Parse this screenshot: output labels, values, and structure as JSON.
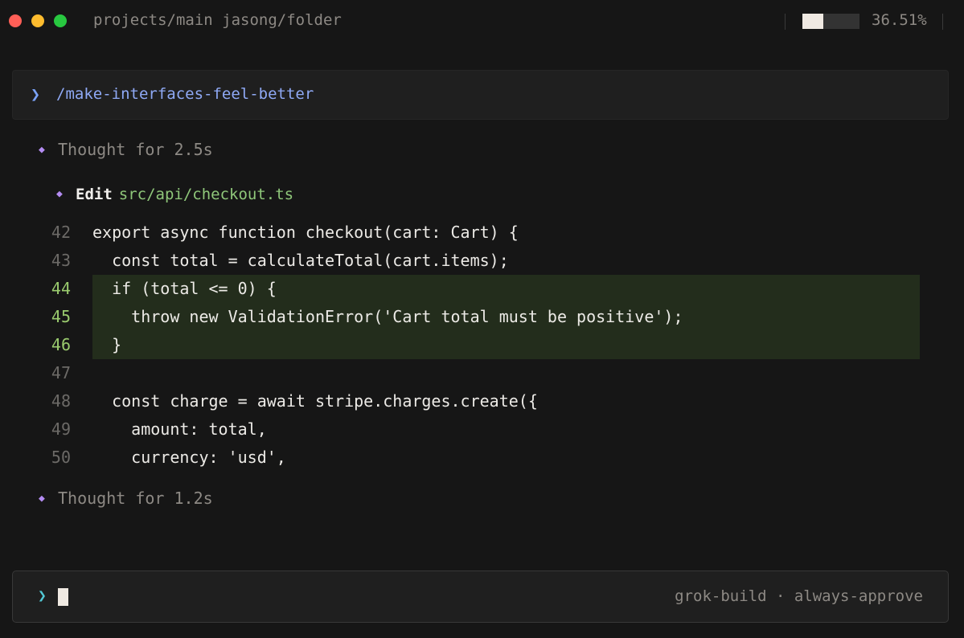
{
  "titlebar": {
    "path": "projects/main jasong/folder",
    "usage_fraction": 0.3651,
    "usage_label": "36.51%"
  },
  "command": {
    "prompt_symbol": "❯",
    "text": "/make-interfaces-feel-better"
  },
  "thoughts": [
    {
      "icon": "diamond-icon",
      "text": "Thought for 2.5s"
    },
    {
      "icon": "diamond-icon",
      "text": "Thought for 1.2s"
    }
  ],
  "edit": {
    "icon": "diamond-icon",
    "label": "Edit",
    "file": "src/api/checkout.ts"
  },
  "code": {
    "lines": [
      {
        "number": "42",
        "text": "export async function checkout(cart: Cart) {",
        "added": false
      },
      {
        "number": "43",
        "text": "  const total = calculateTotal(cart.items);",
        "added": false
      },
      {
        "number": "44",
        "text": "  if (total <= 0) {",
        "added": true
      },
      {
        "number": "45",
        "text": "    throw new ValidationError('Cart total must be positive');",
        "added": true
      },
      {
        "number": "46",
        "text": "  }",
        "added": true
      },
      {
        "number": "47",
        "text": "",
        "added": false
      },
      {
        "number": "48",
        "text": "  const charge = await stripe.charges.create({",
        "added": false
      },
      {
        "number": "49",
        "text": "    amount: total,",
        "added": false
      },
      {
        "number": "50",
        "text": "    currency: 'usd',",
        "added": false
      }
    ]
  },
  "input": {
    "prompt_symbol": "❯",
    "value": "",
    "status": "grok-build · always-approve"
  },
  "colors": {
    "background": "#161616",
    "accent_purple": "#b48cf2",
    "command_blue": "#8fa9f5",
    "file_green": "#8fc77a",
    "added_bg": "#232d1c",
    "added_line_number": "#9acb6e",
    "input_chevron": "#52c9d6"
  }
}
